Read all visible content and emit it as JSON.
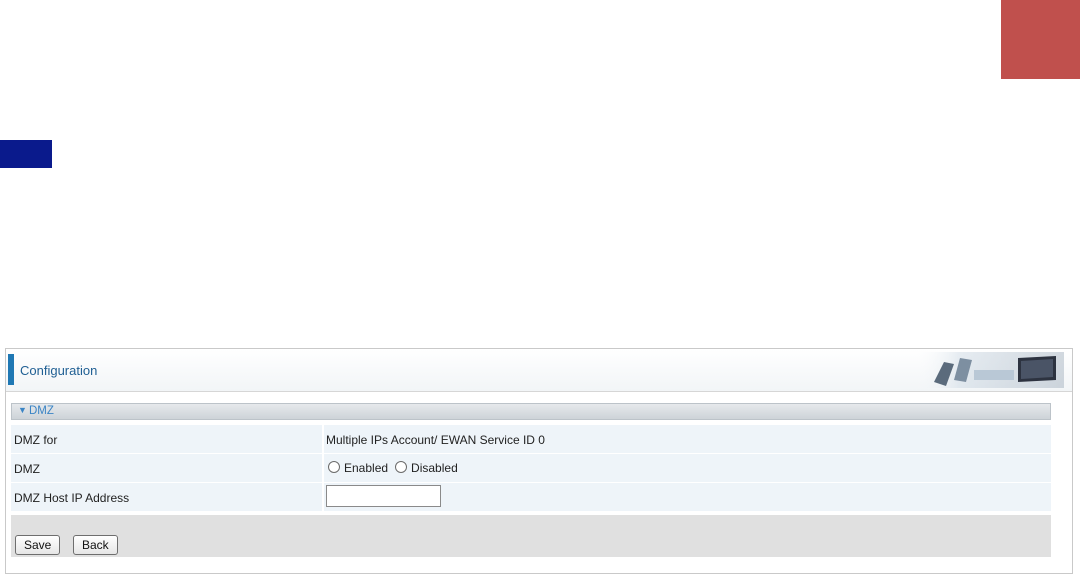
{
  "colors": {
    "corner_block": "#c0504d",
    "nav_block": "#0a1a8c",
    "accent": "#1f78b4",
    "section_text": "#3a84c5"
  },
  "panel": {
    "title": "Configuration",
    "section": {
      "arrow_icon": "caret-down-icon",
      "title": "DMZ"
    },
    "rows": [
      {
        "label": "DMZ for",
        "value": "Multiple IPs Account/ EWAN Service ID 0"
      },
      {
        "label": "DMZ",
        "options": [
          "Enabled",
          "Disabled"
        ],
        "selected": ""
      },
      {
        "label": "DMZ Host IP Address",
        "value": ""
      }
    ],
    "buttons": {
      "save": "Save",
      "back": "Back"
    }
  }
}
